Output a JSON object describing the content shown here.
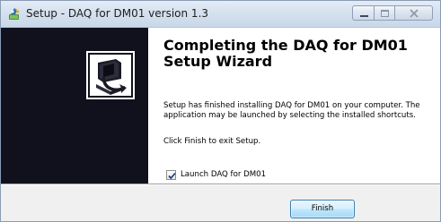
{
  "window": {
    "title": "Setup - DAQ for DM01 version 1.3",
    "icons": {
      "app": "setup-installer-icon",
      "minimize": "minimize-icon",
      "maximize": "maximize-icon",
      "close": "close-icon"
    }
  },
  "banner": {
    "logo": "installer-computer-logo-icon",
    "background_color": "#11111e"
  },
  "content": {
    "heading": "Completing the DAQ for DM01 Setup Wizard",
    "paragraph1": "Setup has finished installing DAQ for DM01 on your computer. The application may be launched by selecting the installed shortcuts.",
    "paragraph2": "Click Finish to exit Setup.",
    "launch_checkbox": {
      "label": "Launch DAQ for DM01",
      "checked": true
    }
  },
  "footer": {
    "finish_label": "Finish"
  }
}
